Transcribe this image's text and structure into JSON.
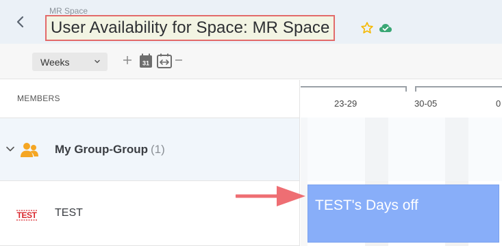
{
  "header": {
    "breadcrumb": "MR Space",
    "title": "User Availability for Space: MR Space"
  },
  "toolbar": {
    "view_select": "Weeks"
  },
  "grid": {
    "members_label": "MEMBERS",
    "weeks": [
      "23-29",
      "30-05",
      "0"
    ]
  },
  "rows": {
    "group": {
      "name": "My Group-Group",
      "count": "(1)"
    },
    "member": {
      "name": "TEST",
      "logo": "TEST"
    }
  },
  "timeline": {
    "event_label": "TEST's Days off"
  },
  "colors": {
    "header_bg": "#ebf1f7",
    "highlight_border": "#e26a6a",
    "star": "#f5b800",
    "cloud_check": "#3aa775",
    "group_icon": "#f5a623",
    "event_bar": "#88aef9",
    "arrow": "#ee6e73"
  },
  "icons": [
    "back-chevron-icon",
    "star-icon",
    "cloud-check-icon",
    "chevron-down-icon",
    "plus-icon",
    "calendar-today-icon",
    "fit-range-icon",
    "minus-icon",
    "group-people-icon",
    "expand-chevron-icon"
  ]
}
